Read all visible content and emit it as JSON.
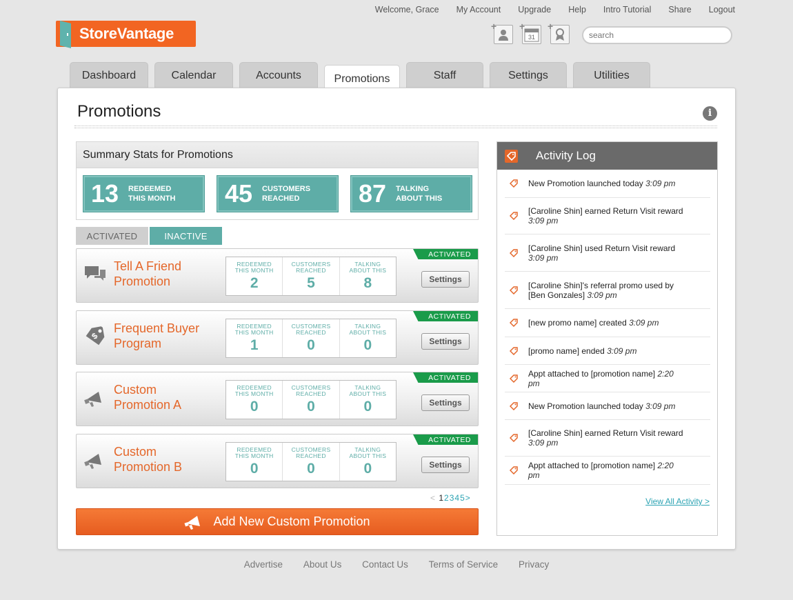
{
  "top_links": [
    "Welcome, Grace",
    "My Account",
    "Upgrade",
    "Help",
    "Intro Tutorial",
    "Share",
    "Logout"
  ],
  "logo": {
    "text": "StoreVantage",
    "color": "#f26522"
  },
  "quick_icons": [
    {
      "name": "add-customer-icon",
      "text": ""
    },
    {
      "name": "add-appointment-icon",
      "text": "31"
    },
    {
      "name": "add-reward-icon",
      "text": ""
    }
  ],
  "search": {
    "placeholder": "search"
  },
  "tabs": [
    "Dashboard",
    "Calendar",
    "Accounts",
    "Promotions",
    "Staff",
    "Settings",
    "Utilities"
  ],
  "active_tab": "Promotions",
  "page": {
    "title": "Promotions"
  },
  "summary": {
    "title": "Summary Stats for Promotions",
    "stats": [
      {
        "value": "13",
        "label_line1": "REDEEMED",
        "label_line2": "THIS MONTH"
      },
      {
        "value": "45",
        "label_line1": "CUSTOMERS",
        "label_line2": "REACHED"
      },
      {
        "value": "87",
        "label_line1": "TALKING",
        "label_line2": "ABOUT THIS"
      }
    ]
  },
  "activation_tabs": {
    "activated": "ACTIVATED",
    "inactive": "INACTIVE"
  },
  "promo_labels": {
    "redeemed": [
      "REDEEMED",
      "THIS MONTH"
    ],
    "reached": [
      "CUSTOMERS",
      "REACHED"
    ],
    "talking": [
      "TALKING",
      "ABOUT THIS"
    ],
    "badge": "ACTIVATED",
    "settings": "Settings"
  },
  "promotions": [
    {
      "name_line1": "Tell A Friend",
      "name_line2": "Promotion",
      "icon": "speech-bubbles-icon",
      "redeemed": "2",
      "reached": "5",
      "talking": "8"
    },
    {
      "name_line1": "Frequent Buyer",
      "name_line2": "Program",
      "icon": "price-tag-icon",
      "redeemed": "1",
      "reached": "0",
      "talking": "0"
    },
    {
      "name_line1": "Custom",
      "name_line2": "Promotion A",
      "icon": "megaphone-icon",
      "redeemed": "0",
      "reached": "0",
      "talking": "0"
    },
    {
      "name_line1": "Custom",
      "name_line2": "Promotion B",
      "icon": "megaphone-icon",
      "redeemed": "0",
      "reached": "0",
      "talking": "0"
    }
  ],
  "pagination": {
    "prev": "<",
    "pages": [
      "1",
      "2",
      "3",
      "4",
      "5"
    ],
    "current": "1",
    "next": ">"
  },
  "add_button": {
    "label": "Add New Custom Promotion"
  },
  "activity_log": {
    "title": "Activity Log",
    "items": [
      {
        "text": "New Promotion launched today",
        "time": "3:09 pm"
      },
      {
        "text": "[Caroline Shin] earned Return Visit reward",
        "time": "3:09 pm"
      },
      {
        "text": "[Caroline Shin] used Return Visit reward",
        "time": "3:09 pm"
      },
      {
        "text": "[Caroline Shin]'s referral promo used by [Ben Gonzales]",
        "time": "3:09 pm"
      },
      {
        "text": "[new promo name] created",
        "time": "3:09 pm"
      },
      {
        "text": "[promo name] ended",
        "time": "3:09 pm"
      },
      {
        "text": "Appt attached to [promotion name]",
        "time": "2:20 pm"
      },
      {
        "text": "New Promotion launched today",
        "time": "3:09 pm"
      },
      {
        "text": "[Caroline Shin] earned Return Visit reward",
        "time": "3:09 pm"
      },
      {
        "text": "Appt attached to [promotion name]",
        "time": "2:20 pm"
      }
    ],
    "view_all": "View All Activity >"
  },
  "footer_links": [
    "Advertise",
    "About Us",
    "Contact Us",
    "Terms of Service",
    "Privacy"
  ],
  "colors": {
    "accent": "#f26522",
    "teal": "#5eada7",
    "green": "#1a9b4a",
    "link": "#2ba3b3"
  }
}
